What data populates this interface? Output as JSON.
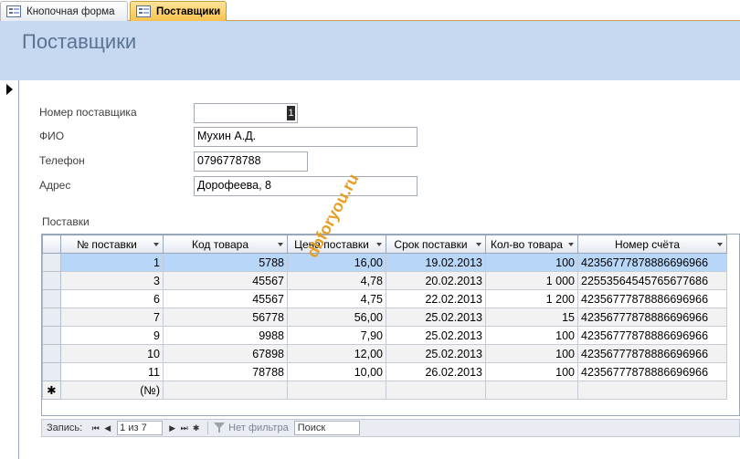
{
  "tabs": [
    {
      "label": "Кнопочная форма",
      "active": false
    },
    {
      "label": "Поставщики",
      "active": true
    }
  ],
  "form": {
    "title": "Поставщики",
    "fields": [
      {
        "label": "Номер поставщика",
        "value": "1"
      },
      {
        "label": "ФИО",
        "value": "Мухин А.Д."
      },
      {
        "label": "Телефон",
        "value": "0796778788"
      },
      {
        "label": "Адрес",
        "value": "Дорофеева, 8"
      }
    ]
  },
  "subform": {
    "label": "Поставки",
    "columns": [
      "№ поставки",
      "Код товара",
      "Цена поставки",
      "Срок поставки",
      "Кол-во товара",
      "Номер счёта"
    ],
    "rows": [
      [
        "1",
        "5788",
        "16,00",
        "19.02.2013",
        "100",
        "42356777878886696966"
      ],
      [
        "3",
        "45567",
        "4,78",
        "20.02.2013",
        "1 000",
        "22553564545765677686"
      ],
      [
        "6",
        "45567",
        "4,75",
        "22.02.2013",
        "1 200",
        "42356777878886696966"
      ],
      [
        "7",
        "56778",
        "56,00",
        "25.02.2013",
        "15",
        "42356777878886696966"
      ],
      [
        "9",
        "9988",
        "7,90",
        "25.02.2013",
        "100",
        "42356777878886696966"
      ],
      [
        "10",
        "67898",
        "12,00",
        "25.02.2013",
        "100",
        "42356777878886696966"
      ],
      [
        "11",
        "78788",
        "10,00",
        "26.02.2013",
        "100",
        "42356777878886696966"
      ]
    ],
    "new_row_marker": "(№)",
    "new_row_symbol": "✱"
  },
  "navigation": {
    "label": "Запись:",
    "position": "1 из 7",
    "filter": "Нет фильтра",
    "search": "Поиск"
  },
  "watermark": "dbforyou.ru",
  "colors": {
    "header_band": "#c6d9f0",
    "active_tab": "#f7c24c",
    "current_row": "#b8d6f8",
    "title_text": "#5b7393",
    "watermark": "#e59a1a"
  }
}
